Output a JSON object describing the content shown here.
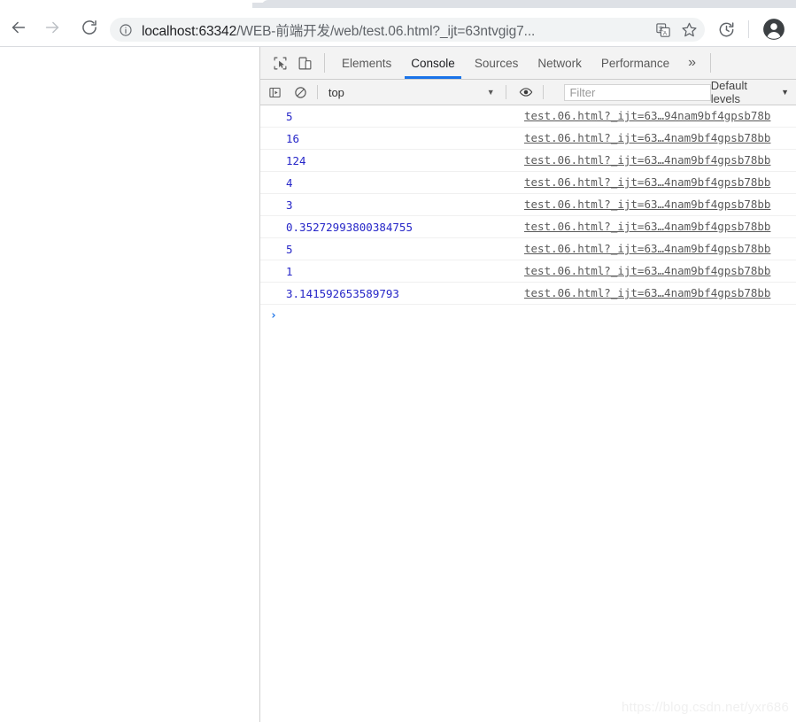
{
  "browser": {
    "nav": {
      "back_label": "Back",
      "forward_label": "Forward",
      "reload_label": "Reload"
    },
    "omnibox": {
      "info_icon": "info-circle-icon",
      "url_host": "localhost:63342",
      "url_path": "/WEB-前端开发/web/test.06.html?_ijt=63ntvgig7...",
      "url_full": "localhost:63342/WEB-前端开发/web/test.06.html?_ijt=63ntvgig7...",
      "translate_icon": "translate-icon",
      "star_icon": "bookmark-star-icon"
    },
    "toolbar_icons": {
      "extension_icon": "history-sync-icon",
      "avatar_icon": "profile-avatar-icon"
    }
  },
  "devtools": {
    "tool_icons": {
      "inspect": "inspect-element-icon",
      "device": "device-toolbar-icon"
    },
    "tabs": [
      {
        "label": "Elements",
        "active": false
      },
      {
        "label": "Console",
        "active": true
      },
      {
        "label": "Sources",
        "active": false
      },
      {
        "label": "Network",
        "active": false
      },
      {
        "label": "Performance",
        "active": false
      }
    ],
    "more_tabs_label": "»",
    "filterbar": {
      "sidebar_icon": "console-sidebar-icon",
      "clear_icon": "clear-console-icon",
      "context": "top",
      "context_caret": "▼",
      "eye_icon": "live-expression-eye-icon",
      "filter_placeholder": "Filter",
      "levels_label": "Default levels",
      "levels_caret": "▼"
    },
    "console": {
      "entries": [
        {
          "value": "5",
          "source": "test.06.html?_ijt=63…94nam9bf4gpsb78b"
        },
        {
          "value": "16",
          "source": "test.06.html?_ijt=63…4nam9bf4gpsb78bb"
        },
        {
          "value": "124",
          "source": "test.06.html?_ijt=63…4nam9bf4gpsb78bb"
        },
        {
          "value": "4",
          "source": "test.06.html?_ijt=63…4nam9bf4gpsb78bb"
        },
        {
          "value": "3",
          "source": "test.06.html?_ijt=63…4nam9bf4gpsb78bb"
        },
        {
          "value": "0.35272993800384755",
          "source": "test.06.html?_ijt=63…4nam9bf4gpsb78bb"
        },
        {
          "value": "5",
          "source": "test.06.html?_ijt=63…4nam9bf4gpsb78bb"
        },
        {
          "value": "1",
          "source": "test.06.html?_ijt=63…4nam9bf4gpsb78bb"
        },
        {
          "value": "3.141592653589793",
          "source": "test.06.html?_ijt=63…4nam9bf4gpsb78bb"
        }
      ],
      "prompt_caret": "›",
      "value_color": "#2626c8"
    }
  },
  "watermark": "https://blog.csdn.net/yxr686"
}
